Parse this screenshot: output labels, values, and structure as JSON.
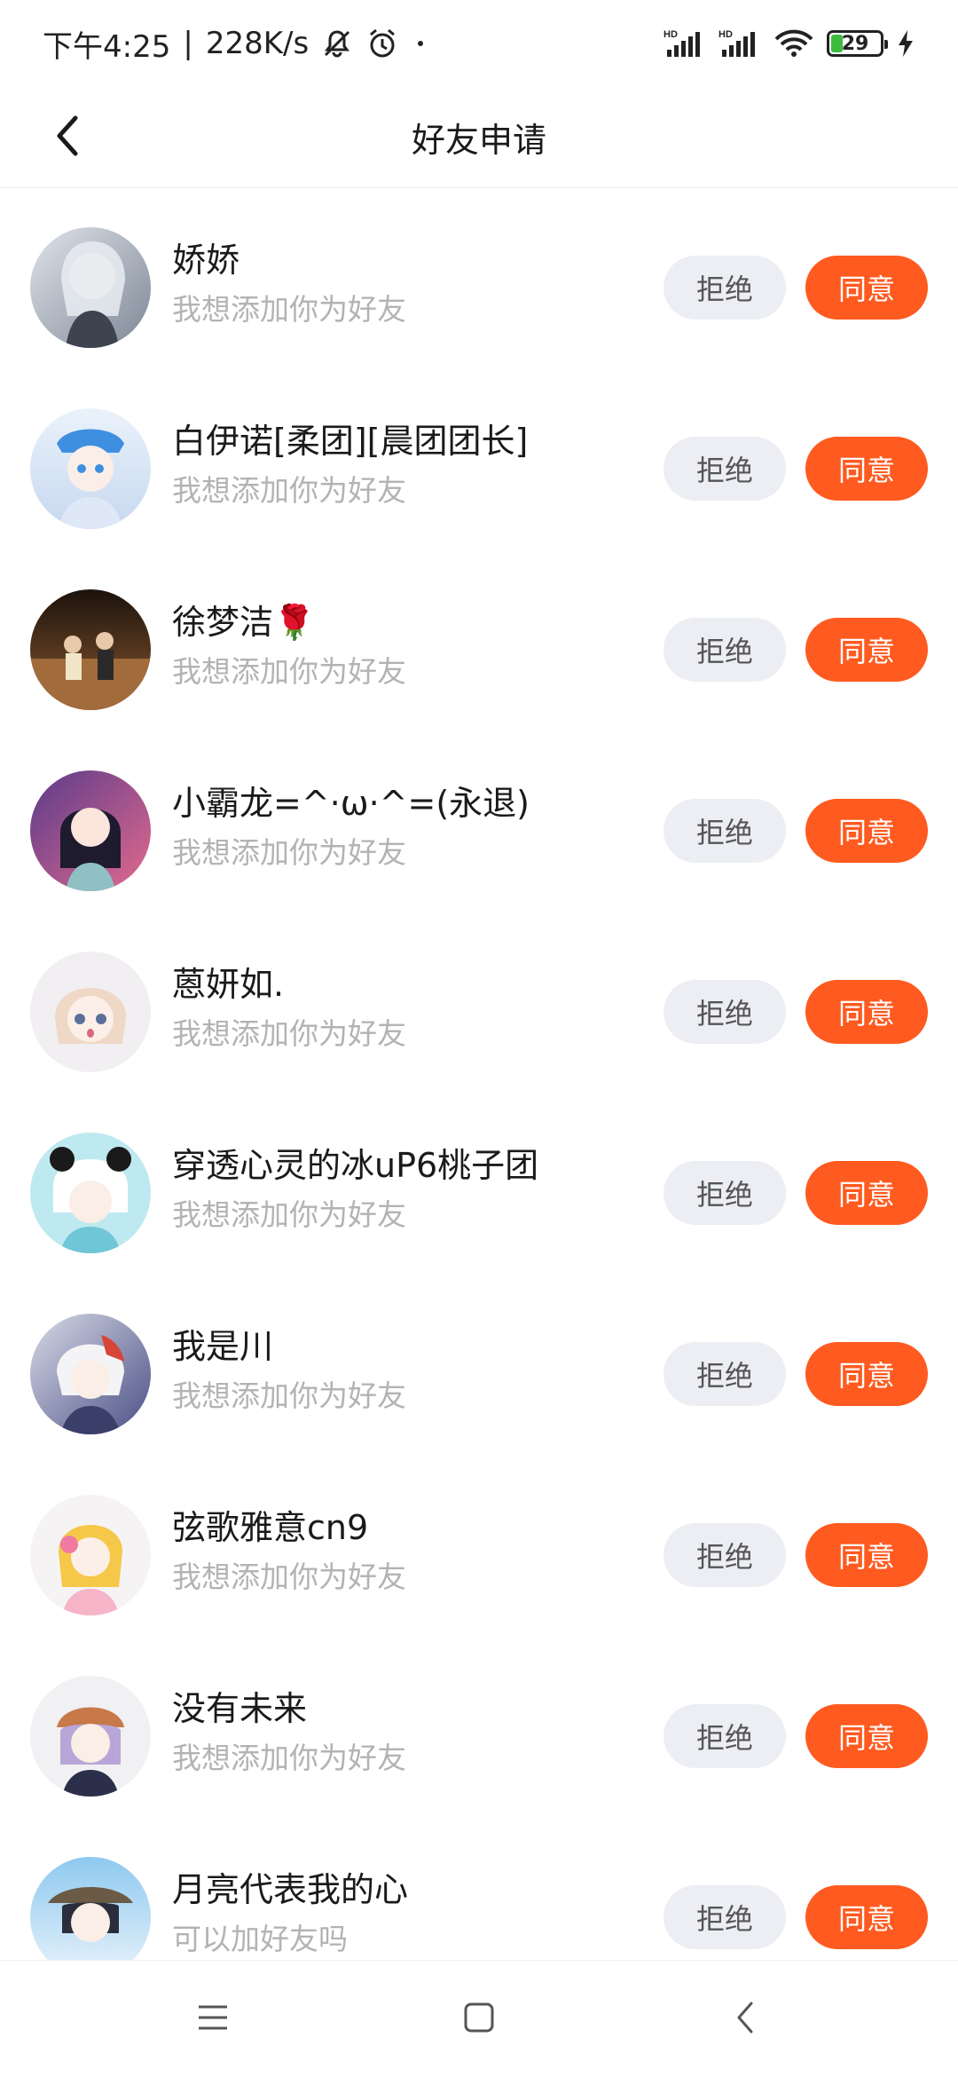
{
  "status_bar": {
    "time": "下午4:25",
    "speed": "228K/s",
    "battery": "29",
    "icons": [
      "mute-icon",
      "alarm-icon",
      "dot-icon",
      "signal-hd-icon",
      "signal-hd-icon",
      "wifi-icon",
      "battery-icon",
      "charging-icon"
    ]
  },
  "header": {
    "title": "好友申请",
    "back_icon": "chevron-left-icon"
  },
  "buttons": {
    "reject": "拒绝",
    "accept": "同意"
  },
  "colors": {
    "accent": "#ff5a1f",
    "reject_bg": "#eceef3",
    "secondary_text": "#b3b3b3"
  },
  "requests": [
    {
      "name": "娇娇",
      "message": "我想添加你为好友"
    },
    {
      "name": "白伊诺[柔团][晨团团长]",
      "message": "我想添加你为好友"
    },
    {
      "name": "徐梦洁🌹",
      "message": "我想添加你为好友"
    },
    {
      "name": "小霸龙=^·ω·^=(永退)",
      "message": "我想添加你为好友"
    },
    {
      "name": "蒽妍如.",
      "message": "我想添加你为好友"
    },
    {
      "name": "穿透心灵的冰uP6桃子团",
      "message": "我想添加你为好友"
    },
    {
      "name": "我是川",
      "message": "我想添加你为好友"
    },
    {
      "name": "弦歌雅意cn9",
      "message": "我想添加你为好友"
    },
    {
      "name": "没有未来",
      "message": "我想添加你为好友"
    },
    {
      "name": "月亮代表我的心",
      "message": "可以加好友吗"
    }
  ],
  "nav_bar": {
    "icons": [
      "menu-icon",
      "home-square-icon",
      "back-chevron-icon"
    ]
  }
}
